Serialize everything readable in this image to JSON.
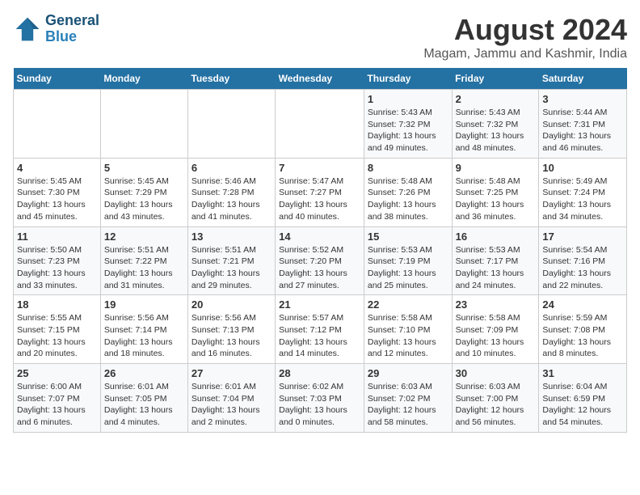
{
  "header": {
    "logo_line1": "General",
    "logo_line2": "Blue",
    "main_title": "August 2024",
    "subtitle": "Magam, Jammu and Kashmir, India"
  },
  "calendar": {
    "days_of_week": [
      "Sunday",
      "Monday",
      "Tuesday",
      "Wednesday",
      "Thursday",
      "Friday",
      "Saturday"
    ],
    "weeks": [
      [
        {
          "day": "",
          "info": ""
        },
        {
          "day": "",
          "info": ""
        },
        {
          "day": "",
          "info": ""
        },
        {
          "day": "",
          "info": ""
        },
        {
          "day": "1",
          "info": "Sunrise: 5:43 AM\nSunset: 7:32 PM\nDaylight: 13 hours\nand 49 minutes."
        },
        {
          "day": "2",
          "info": "Sunrise: 5:43 AM\nSunset: 7:32 PM\nDaylight: 13 hours\nand 48 minutes."
        },
        {
          "day": "3",
          "info": "Sunrise: 5:44 AM\nSunset: 7:31 PM\nDaylight: 13 hours\nand 46 minutes."
        }
      ],
      [
        {
          "day": "4",
          "info": "Sunrise: 5:45 AM\nSunset: 7:30 PM\nDaylight: 13 hours\nand 45 minutes."
        },
        {
          "day": "5",
          "info": "Sunrise: 5:45 AM\nSunset: 7:29 PM\nDaylight: 13 hours\nand 43 minutes."
        },
        {
          "day": "6",
          "info": "Sunrise: 5:46 AM\nSunset: 7:28 PM\nDaylight: 13 hours\nand 41 minutes."
        },
        {
          "day": "7",
          "info": "Sunrise: 5:47 AM\nSunset: 7:27 PM\nDaylight: 13 hours\nand 40 minutes."
        },
        {
          "day": "8",
          "info": "Sunrise: 5:48 AM\nSunset: 7:26 PM\nDaylight: 13 hours\nand 38 minutes."
        },
        {
          "day": "9",
          "info": "Sunrise: 5:48 AM\nSunset: 7:25 PM\nDaylight: 13 hours\nand 36 minutes."
        },
        {
          "day": "10",
          "info": "Sunrise: 5:49 AM\nSunset: 7:24 PM\nDaylight: 13 hours\nand 34 minutes."
        }
      ],
      [
        {
          "day": "11",
          "info": "Sunrise: 5:50 AM\nSunset: 7:23 PM\nDaylight: 13 hours\nand 33 minutes."
        },
        {
          "day": "12",
          "info": "Sunrise: 5:51 AM\nSunset: 7:22 PM\nDaylight: 13 hours\nand 31 minutes."
        },
        {
          "day": "13",
          "info": "Sunrise: 5:51 AM\nSunset: 7:21 PM\nDaylight: 13 hours\nand 29 minutes."
        },
        {
          "day": "14",
          "info": "Sunrise: 5:52 AM\nSunset: 7:20 PM\nDaylight: 13 hours\nand 27 minutes."
        },
        {
          "day": "15",
          "info": "Sunrise: 5:53 AM\nSunset: 7:19 PM\nDaylight: 13 hours\nand 25 minutes."
        },
        {
          "day": "16",
          "info": "Sunrise: 5:53 AM\nSunset: 7:17 PM\nDaylight: 13 hours\nand 24 minutes."
        },
        {
          "day": "17",
          "info": "Sunrise: 5:54 AM\nSunset: 7:16 PM\nDaylight: 13 hours\nand 22 minutes."
        }
      ],
      [
        {
          "day": "18",
          "info": "Sunrise: 5:55 AM\nSunset: 7:15 PM\nDaylight: 13 hours\nand 20 minutes."
        },
        {
          "day": "19",
          "info": "Sunrise: 5:56 AM\nSunset: 7:14 PM\nDaylight: 13 hours\nand 18 minutes."
        },
        {
          "day": "20",
          "info": "Sunrise: 5:56 AM\nSunset: 7:13 PM\nDaylight: 13 hours\nand 16 minutes."
        },
        {
          "day": "21",
          "info": "Sunrise: 5:57 AM\nSunset: 7:12 PM\nDaylight: 13 hours\nand 14 minutes."
        },
        {
          "day": "22",
          "info": "Sunrise: 5:58 AM\nSunset: 7:10 PM\nDaylight: 13 hours\nand 12 minutes."
        },
        {
          "day": "23",
          "info": "Sunrise: 5:58 AM\nSunset: 7:09 PM\nDaylight: 13 hours\nand 10 minutes."
        },
        {
          "day": "24",
          "info": "Sunrise: 5:59 AM\nSunset: 7:08 PM\nDaylight: 13 hours\nand 8 minutes."
        }
      ],
      [
        {
          "day": "25",
          "info": "Sunrise: 6:00 AM\nSunset: 7:07 PM\nDaylight: 13 hours\nand 6 minutes."
        },
        {
          "day": "26",
          "info": "Sunrise: 6:01 AM\nSunset: 7:05 PM\nDaylight: 13 hours\nand 4 minutes."
        },
        {
          "day": "27",
          "info": "Sunrise: 6:01 AM\nSunset: 7:04 PM\nDaylight: 13 hours\nand 2 minutes."
        },
        {
          "day": "28",
          "info": "Sunrise: 6:02 AM\nSunset: 7:03 PM\nDaylight: 13 hours\nand 0 minutes."
        },
        {
          "day": "29",
          "info": "Sunrise: 6:03 AM\nSunset: 7:02 PM\nDaylight: 12 hours\nand 58 minutes."
        },
        {
          "day": "30",
          "info": "Sunrise: 6:03 AM\nSunset: 7:00 PM\nDaylight: 12 hours\nand 56 minutes."
        },
        {
          "day": "31",
          "info": "Sunrise: 6:04 AM\nSunset: 6:59 PM\nDaylight: 12 hours\nand 54 minutes."
        }
      ]
    ]
  }
}
